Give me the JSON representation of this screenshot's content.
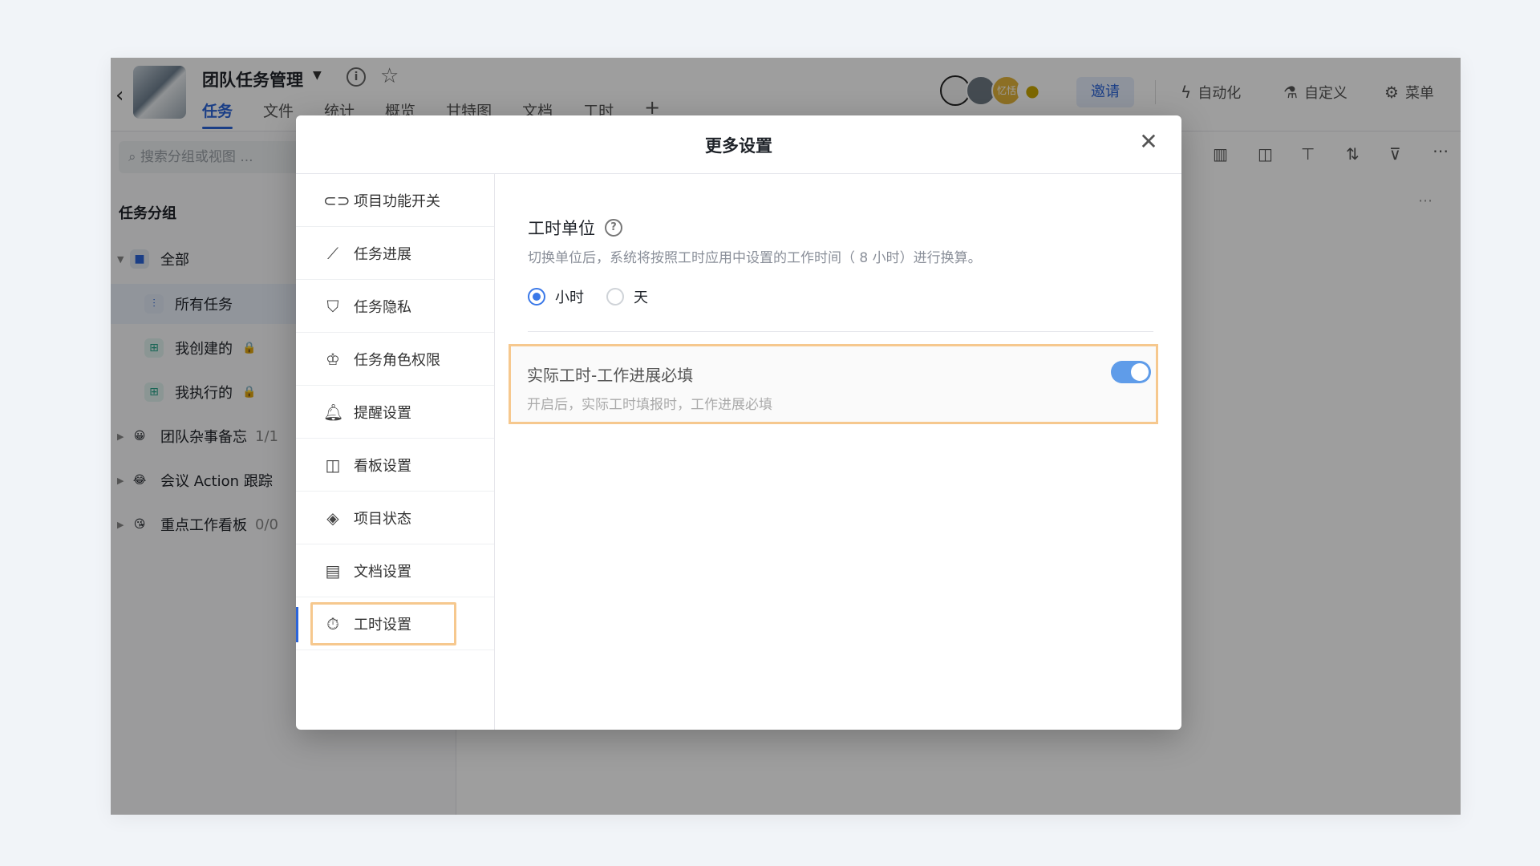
{
  "header": {
    "title": "团队任务管理",
    "tabs": [
      "任务",
      "文件",
      "统计",
      "概览",
      "甘特图",
      "文档",
      "工时"
    ],
    "member_badge": "忆恬",
    "invite": "邀请",
    "automation": "自动化",
    "customize": "自定义",
    "menu": "菜单"
  },
  "sidebar": {
    "search_placeholder": "搜索分组或视图 ...",
    "group_title": "任务分组",
    "items": [
      {
        "label": "全部"
      },
      {
        "label": "所有任务"
      },
      {
        "label": "我创建的"
      },
      {
        "label": "我执行的"
      },
      {
        "label": "团队杂事备忘",
        "count": "1/1"
      },
      {
        "label": "会议 Action 跟踪"
      },
      {
        "label": "重点工作看板",
        "count": "0/0"
      }
    ]
  },
  "modal": {
    "title": "更多设置",
    "nav": [
      {
        "label": "项目功能开关",
        "icon": "toggle-icon"
      },
      {
        "label": "任务进展",
        "icon": "progress-icon"
      },
      {
        "label": "任务隐私",
        "icon": "shield-icon"
      },
      {
        "label": "任务角色权限",
        "icon": "crown-icon"
      },
      {
        "label": "提醒设置",
        "icon": "bell-icon"
      },
      {
        "label": "看板设置",
        "icon": "kanban-icon"
      },
      {
        "label": "项目状态",
        "icon": "layers-icon"
      },
      {
        "label": "文档设置",
        "icon": "document-icon"
      },
      {
        "label": "工时设置",
        "icon": "timer-icon"
      }
    ],
    "active_nav": "工时设置",
    "unit_section": {
      "title": "工时单位",
      "description": "切换单位后，系统将按照工时应用中设置的工作时间（ 8 小时）进行换算。",
      "options": [
        "小时",
        "天"
      ],
      "selected": "小时"
    },
    "setting": {
      "title": "实际工时-工作进展必填",
      "description": "开启后，实际工时填报时，工作进展必填",
      "enabled": true
    }
  },
  "colors": {
    "accent": "#2b64d9",
    "highlight_border": "#f6c88e",
    "toggle_on": "#5f9ce9"
  }
}
